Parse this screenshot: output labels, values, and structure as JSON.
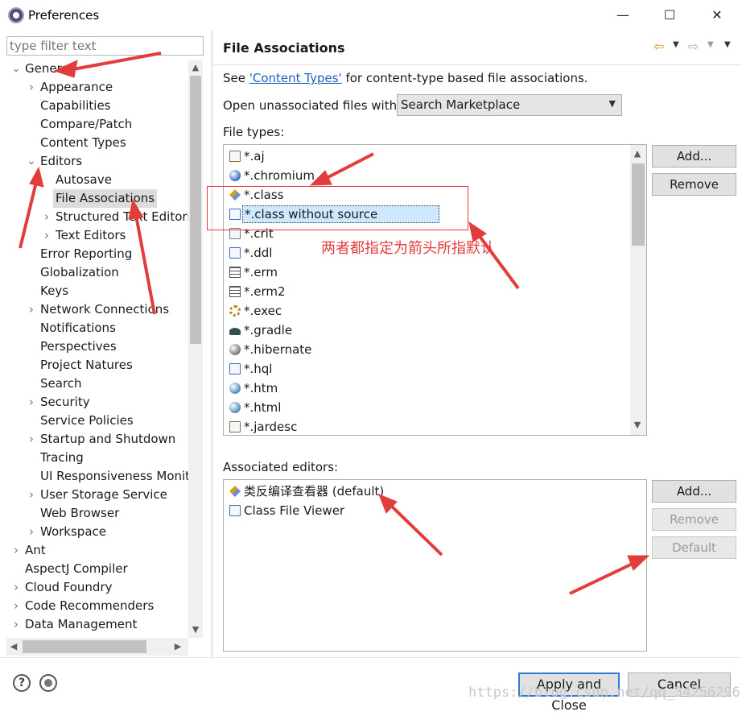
{
  "window": {
    "title": "Preferences",
    "minimize": "—",
    "maximize": "☐",
    "close": "✕"
  },
  "filter": {
    "placeholder": "type filter text"
  },
  "tree": [
    {
      "label": "General",
      "level": 0,
      "twisty": "expanded"
    },
    {
      "label": "Appearance",
      "level": 1,
      "twisty": "collapsed"
    },
    {
      "label": "Capabilities",
      "level": 1,
      "twisty": ""
    },
    {
      "label": "Compare/Patch",
      "level": 1,
      "twisty": ""
    },
    {
      "label": "Content Types",
      "level": 1,
      "twisty": ""
    },
    {
      "label": "Editors",
      "level": 1,
      "twisty": "expanded"
    },
    {
      "label": "Autosave",
      "level": 2,
      "twisty": ""
    },
    {
      "label": "File Associations",
      "level": 2,
      "twisty": "",
      "selected": true
    },
    {
      "label": "Structured Text Editors",
      "level": 2,
      "twisty": "collapsed"
    },
    {
      "label": "Text Editors",
      "level": 2,
      "twisty": "collapsed"
    },
    {
      "label": "Error Reporting",
      "level": 1,
      "twisty": ""
    },
    {
      "label": "Globalization",
      "level": 1,
      "twisty": ""
    },
    {
      "label": "Keys",
      "level": 1,
      "twisty": ""
    },
    {
      "label": "Network Connections",
      "level": 1,
      "twisty": "collapsed"
    },
    {
      "label": "Notifications",
      "level": 1,
      "twisty": ""
    },
    {
      "label": "Perspectives",
      "level": 1,
      "twisty": ""
    },
    {
      "label": "Project Natures",
      "level": 1,
      "twisty": ""
    },
    {
      "label": "Search",
      "level": 1,
      "twisty": ""
    },
    {
      "label": "Security",
      "level": 1,
      "twisty": "collapsed"
    },
    {
      "label": "Service Policies",
      "level": 1,
      "twisty": ""
    },
    {
      "label": "Startup and Shutdown",
      "level": 1,
      "twisty": "collapsed"
    },
    {
      "label": "Tracing",
      "level": 1,
      "twisty": ""
    },
    {
      "label": "UI Responsiveness Monitoring",
      "level": 1,
      "twisty": ""
    },
    {
      "label": "User Storage Service",
      "level": 1,
      "twisty": "collapsed"
    },
    {
      "label": "Web Browser",
      "level": 1,
      "twisty": ""
    },
    {
      "label": "Workspace",
      "level": 1,
      "twisty": "collapsed"
    },
    {
      "label": "Ant",
      "level": 0,
      "twisty": "collapsed"
    },
    {
      "label": "AspectJ Compiler",
      "level": 0,
      "twisty": ""
    },
    {
      "label": "Cloud Foundry",
      "level": 0,
      "twisty": "collapsed"
    },
    {
      "label": "Code Recommenders",
      "level": 0,
      "twisty": "collapsed"
    },
    {
      "label": "Data Management",
      "level": 0,
      "twisty": "collapsed"
    }
  ],
  "page": {
    "title": "File Associations",
    "see_prefix": "See ",
    "see_link": "'Content Types'",
    "see_suffix": " for content-type based file associations.",
    "open_label": "Open unassociated files with:",
    "open_value": "Search Marketplace",
    "file_types_label": "File types:",
    "associated_editors_label": "Associated editors:"
  },
  "file_types": [
    {
      "label": "*.aj",
      "icon": "aspectj-file-icon",
      "color": "#8a6d3b"
    },
    {
      "label": "*.chromium",
      "icon": "chromium-icon",
      "color": "#3b6fc4"
    },
    {
      "label": "*.class",
      "icon": "class-decompiler-icon",
      "color": "#d4a017"
    },
    {
      "label": "*.class without source",
      "icon": "class-file-icon",
      "color": "#3b6fc4",
      "selected": true
    },
    {
      "label": "*.crit",
      "icon": "crit-file-icon",
      "color": "#777777"
    },
    {
      "label": "*.ddl",
      "icon": "ddl-file-icon",
      "color": "#3b6fc4"
    },
    {
      "label": "*.erm",
      "icon": "table-icon",
      "color": "#555555"
    },
    {
      "label": "*.erm2",
      "icon": "table-icon",
      "color": "#555555"
    },
    {
      "label": "*.exec",
      "icon": "gears-icon",
      "color": "#b8860b"
    },
    {
      "label": "*.gradle",
      "icon": "gradle-icon",
      "color": "#2f4f4f"
    },
    {
      "label": "*.hibernate",
      "icon": "hibernate-icon",
      "color": "#777777"
    },
    {
      "label": "*.hql",
      "icon": "hql-file-icon",
      "color": "#3b6fc4"
    },
    {
      "label": "*.htm",
      "icon": "globe-icon",
      "color": "#4a8fb5"
    },
    {
      "label": "*.html",
      "icon": "globe-icon",
      "color": "#4a8fb5"
    },
    {
      "label": "*.jardesc",
      "icon": "jardesc-file-icon",
      "color": "#8a6d3b"
    }
  ],
  "file_type_buttons": {
    "add": "Add...",
    "remove": "Remove"
  },
  "associated_editors": [
    {
      "label": "类反编译查看器 (default)",
      "icon": "class-decompiler-icon",
      "color": "#d4a017"
    },
    {
      "label": "Class File Viewer",
      "icon": "class-file-icon",
      "color": "#3b6fc4"
    }
  ],
  "editor_buttons": {
    "add": "Add...",
    "remove": "Remove",
    "default": "Default"
  },
  "footer": {
    "help": "?",
    "apply_close": "Apply and Close",
    "cancel": "Cancel"
  },
  "annotation": {
    "text": "两者都指定为箭头所指默认",
    "color": "#e23c3c"
  },
  "watermark": "https://blog.csdn.net/qq_34256296"
}
